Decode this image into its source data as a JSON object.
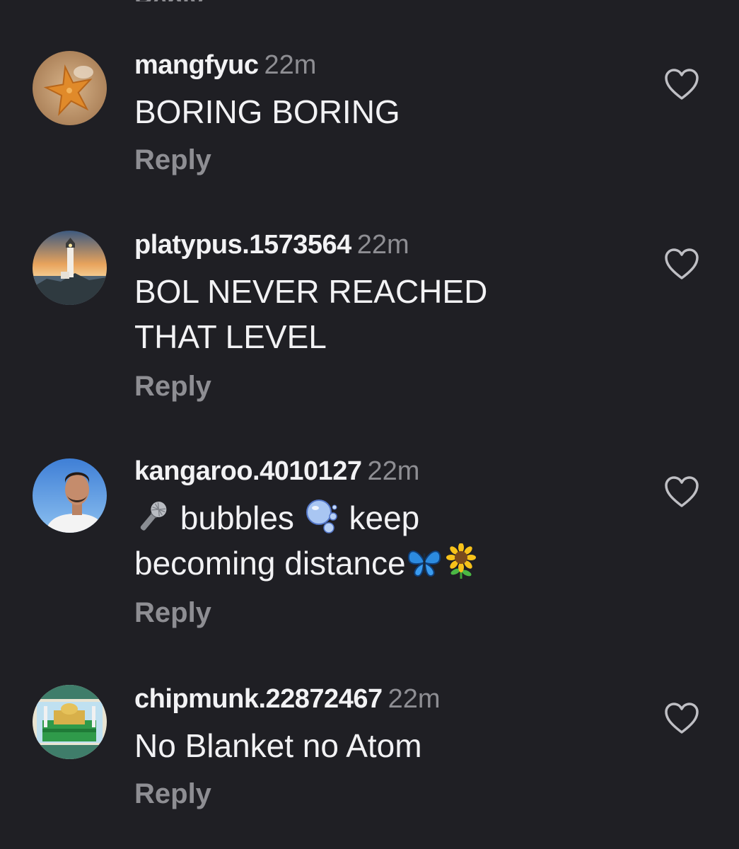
{
  "comments": [
    {
      "username": "mangfyuc",
      "time": "22m",
      "text": "BORING BORING",
      "reply_label": "Reply",
      "avatar_icon": "starfish-avatar",
      "like_icon": "heart-outline-icon"
    },
    {
      "username": "platypus.1573564",
      "time": "22m",
      "text_lines": [
        "BOL NEVER REACHED",
        "THAT LEVEL"
      ],
      "reply_label": "Reply",
      "avatar_icon": "lighthouse-avatar",
      "like_icon": "heart-outline-icon"
    },
    {
      "username": "kangaroo.4010127",
      "time": "22m",
      "text_parts": {
        "line1_a": "bubbles",
        "line1_b": "keep",
        "line2": "becoming distance"
      },
      "emojis": [
        "microphone",
        "bubbles",
        "butterfly",
        "sunflower"
      ],
      "reply_label": "Reply",
      "avatar_icon": "man-portrait-avatar",
      "like_icon": "heart-outline-icon"
    },
    {
      "username": "chipmunk.22872467",
      "time": "22m",
      "text": "No Blanket no Atom",
      "reply_label": "Reply",
      "avatar_icon": "shrine-avatar",
      "like_icon": "heart-outline-icon"
    }
  ],
  "colors": {
    "background": "#1f1f24",
    "primary_text": "#f2f2f4",
    "secondary_text": "#8e8e93"
  }
}
